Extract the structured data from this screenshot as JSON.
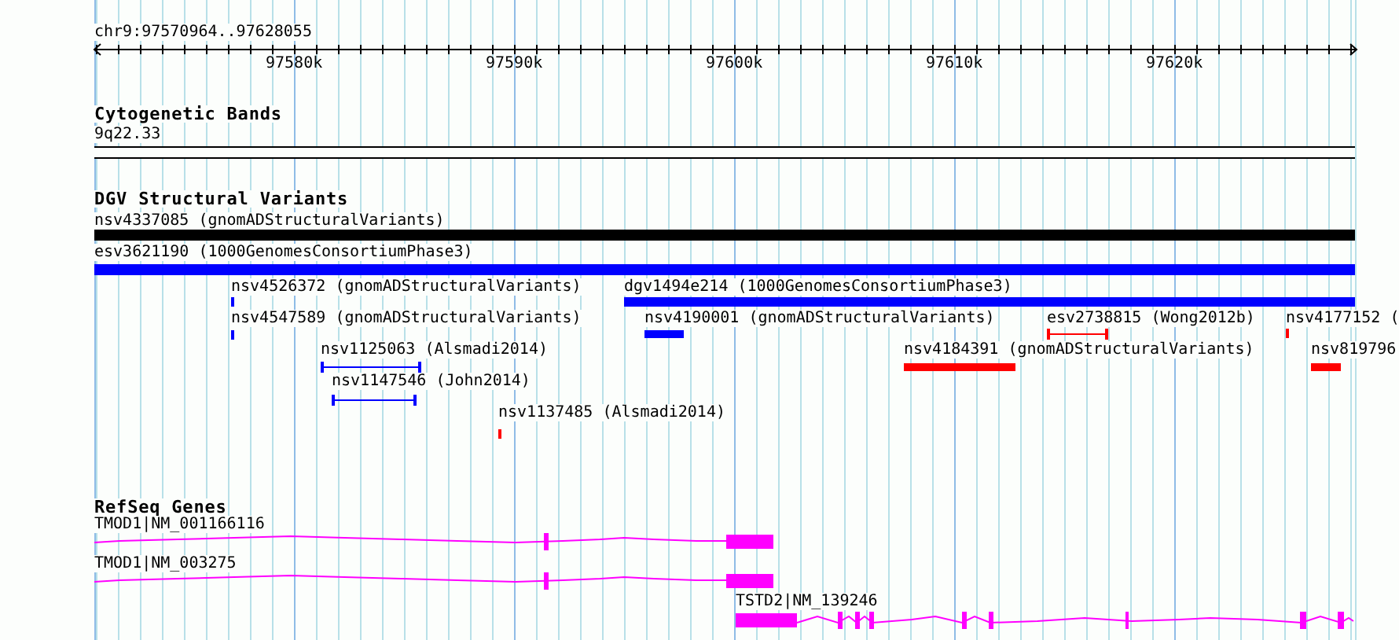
{
  "ruler": {
    "location": "chr9:97570964..97628055",
    "ticks": [
      "97580k",
      "97590k",
      "97600k",
      "97610k",
      "97620k"
    ]
  },
  "tracks": [
    {
      "title": "Cytogenetic Bands",
      "kind": "bands",
      "features": [
        {
          "label": "9q22.33"
        }
      ]
    },
    {
      "title": "DGV Structural Variants",
      "kind": "variants",
      "features": [
        {
          "label": "nsv4337085 (gnomADStructuralVariants)",
          "kind": "block",
          "color": "#000000"
        },
        {
          "label": "esv3621190 (1000GenomesConsortiumPhase3)",
          "kind": "block",
          "color": "#0000ff"
        },
        {
          "label": "nsv4526372 (gnomADStructuralVariants)",
          "kind": "block",
          "color": "#0000ff"
        },
        {
          "label": "dgv1494e214 (1000GenomesConsortiumPhase3)",
          "kind": "block",
          "color": "#0000ff"
        },
        {
          "label": "nsv4547589 (gnomADStructuralVariants)",
          "kind": "block",
          "color": "#0000ff"
        },
        {
          "label": "nsv4190001 (gnomADStructuralVariants)",
          "kind": "block",
          "color": "#0000ff"
        },
        {
          "label": "esv2738815 (Wong2012b)",
          "kind": "range",
          "color": "#ff0000"
        },
        {
          "label": "nsv4177152 (",
          "kind": "block",
          "color": "#ff0000"
        },
        {
          "label": "nsv1125063 (Alsmadi2014)",
          "kind": "range",
          "color": "#0000ff"
        },
        {
          "label": "nsv4184391 (gnomADStructuralVariants)",
          "kind": "block",
          "color": "#ff0000"
        },
        {
          "label": "nsv819796",
          "kind": "block",
          "color": "#ff0000"
        },
        {
          "label": "nsv1147546 (John2014)",
          "kind": "range",
          "color": "#0000ff"
        },
        {
          "label": "nsv1137485 (Alsmadi2014)",
          "kind": "block",
          "color": "#ff0000"
        }
      ]
    },
    {
      "title": "RefSeq Genes",
      "kind": "genes",
      "features": [
        {
          "label": "TMOD1|NM_001166116"
        },
        {
          "label": "TMOD1|NM_003275"
        },
        {
          "label": "TSTD2|NM_139246"
        }
      ]
    }
  ]
}
